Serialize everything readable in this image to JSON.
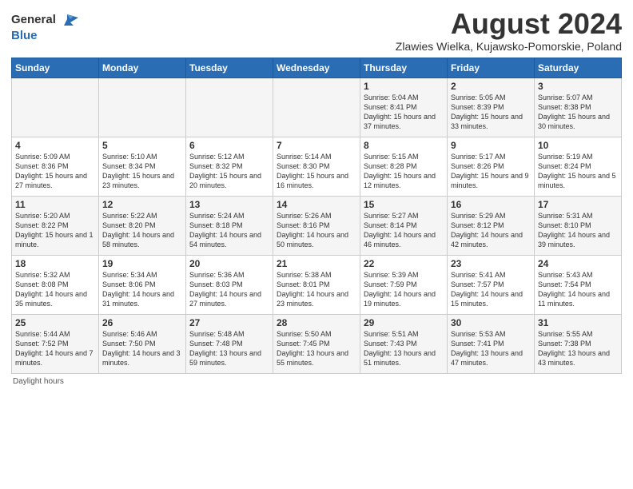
{
  "header": {
    "logo_general": "General",
    "logo_blue": "Blue",
    "title": "August 2024",
    "subtitle": "Zlawies Wielka, Kujawsko-Pomorskie, Poland"
  },
  "days_of_week": [
    "Sunday",
    "Monday",
    "Tuesday",
    "Wednesday",
    "Thursday",
    "Friday",
    "Saturday"
  ],
  "weeks": [
    [
      {
        "day": "",
        "content": ""
      },
      {
        "day": "",
        "content": ""
      },
      {
        "day": "",
        "content": ""
      },
      {
        "day": "",
        "content": ""
      },
      {
        "day": "1",
        "content": "Sunrise: 5:04 AM\nSunset: 8:41 PM\nDaylight: 15 hours\nand 37 minutes."
      },
      {
        "day": "2",
        "content": "Sunrise: 5:05 AM\nSunset: 8:39 PM\nDaylight: 15 hours\nand 33 minutes."
      },
      {
        "day": "3",
        "content": "Sunrise: 5:07 AM\nSunset: 8:38 PM\nDaylight: 15 hours\nand 30 minutes."
      }
    ],
    [
      {
        "day": "4",
        "content": "Sunrise: 5:09 AM\nSunset: 8:36 PM\nDaylight: 15 hours\nand 27 minutes."
      },
      {
        "day": "5",
        "content": "Sunrise: 5:10 AM\nSunset: 8:34 PM\nDaylight: 15 hours\nand 23 minutes."
      },
      {
        "day": "6",
        "content": "Sunrise: 5:12 AM\nSunset: 8:32 PM\nDaylight: 15 hours\nand 20 minutes."
      },
      {
        "day": "7",
        "content": "Sunrise: 5:14 AM\nSunset: 8:30 PM\nDaylight: 15 hours\nand 16 minutes."
      },
      {
        "day": "8",
        "content": "Sunrise: 5:15 AM\nSunset: 8:28 PM\nDaylight: 15 hours\nand 12 minutes."
      },
      {
        "day": "9",
        "content": "Sunrise: 5:17 AM\nSunset: 8:26 PM\nDaylight: 15 hours\nand 9 minutes."
      },
      {
        "day": "10",
        "content": "Sunrise: 5:19 AM\nSunset: 8:24 PM\nDaylight: 15 hours\nand 5 minutes."
      }
    ],
    [
      {
        "day": "11",
        "content": "Sunrise: 5:20 AM\nSunset: 8:22 PM\nDaylight: 15 hours\nand 1 minute."
      },
      {
        "day": "12",
        "content": "Sunrise: 5:22 AM\nSunset: 8:20 PM\nDaylight: 14 hours\nand 58 minutes."
      },
      {
        "day": "13",
        "content": "Sunrise: 5:24 AM\nSunset: 8:18 PM\nDaylight: 14 hours\nand 54 minutes."
      },
      {
        "day": "14",
        "content": "Sunrise: 5:26 AM\nSunset: 8:16 PM\nDaylight: 14 hours\nand 50 minutes."
      },
      {
        "day": "15",
        "content": "Sunrise: 5:27 AM\nSunset: 8:14 PM\nDaylight: 14 hours\nand 46 minutes."
      },
      {
        "day": "16",
        "content": "Sunrise: 5:29 AM\nSunset: 8:12 PM\nDaylight: 14 hours\nand 42 minutes."
      },
      {
        "day": "17",
        "content": "Sunrise: 5:31 AM\nSunset: 8:10 PM\nDaylight: 14 hours\nand 39 minutes."
      }
    ],
    [
      {
        "day": "18",
        "content": "Sunrise: 5:32 AM\nSunset: 8:08 PM\nDaylight: 14 hours\nand 35 minutes."
      },
      {
        "day": "19",
        "content": "Sunrise: 5:34 AM\nSunset: 8:06 PM\nDaylight: 14 hours\nand 31 minutes."
      },
      {
        "day": "20",
        "content": "Sunrise: 5:36 AM\nSunset: 8:03 PM\nDaylight: 14 hours\nand 27 minutes."
      },
      {
        "day": "21",
        "content": "Sunrise: 5:38 AM\nSunset: 8:01 PM\nDaylight: 14 hours\nand 23 minutes."
      },
      {
        "day": "22",
        "content": "Sunrise: 5:39 AM\nSunset: 7:59 PM\nDaylight: 14 hours\nand 19 minutes."
      },
      {
        "day": "23",
        "content": "Sunrise: 5:41 AM\nSunset: 7:57 PM\nDaylight: 14 hours\nand 15 minutes."
      },
      {
        "day": "24",
        "content": "Sunrise: 5:43 AM\nSunset: 7:54 PM\nDaylight: 14 hours\nand 11 minutes."
      }
    ],
    [
      {
        "day": "25",
        "content": "Sunrise: 5:44 AM\nSunset: 7:52 PM\nDaylight: 14 hours\nand 7 minutes."
      },
      {
        "day": "26",
        "content": "Sunrise: 5:46 AM\nSunset: 7:50 PM\nDaylight: 14 hours\nand 3 minutes."
      },
      {
        "day": "27",
        "content": "Sunrise: 5:48 AM\nSunset: 7:48 PM\nDaylight: 13 hours\nand 59 minutes."
      },
      {
        "day": "28",
        "content": "Sunrise: 5:50 AM\nSunset: 7:45 PM\nDaylight: 13 hours\nand 55 minutes."
      },
      {
        "day": "29",
        "content": "Sunrise: 5:51 AM\nSunset: 7:43 PM\nDaylight: 13 hours\nand 51 minutes."
      },
      {
        "day": "30",
        "content": "Sunrise: 5:53 AM\nSunset: 7:41 PM\nDaylight: 13 hours\nand 47 minutes."
      },
      {
        "day": "31",
        "content": "Sunrise: 5:55 AM\nSunset: 7:38 PM\nDaylight: 13 hours\nand 43 minutes."
      }
    ]
  ],
  "footer": {
    "note": "Daylight hours"
  }
}
